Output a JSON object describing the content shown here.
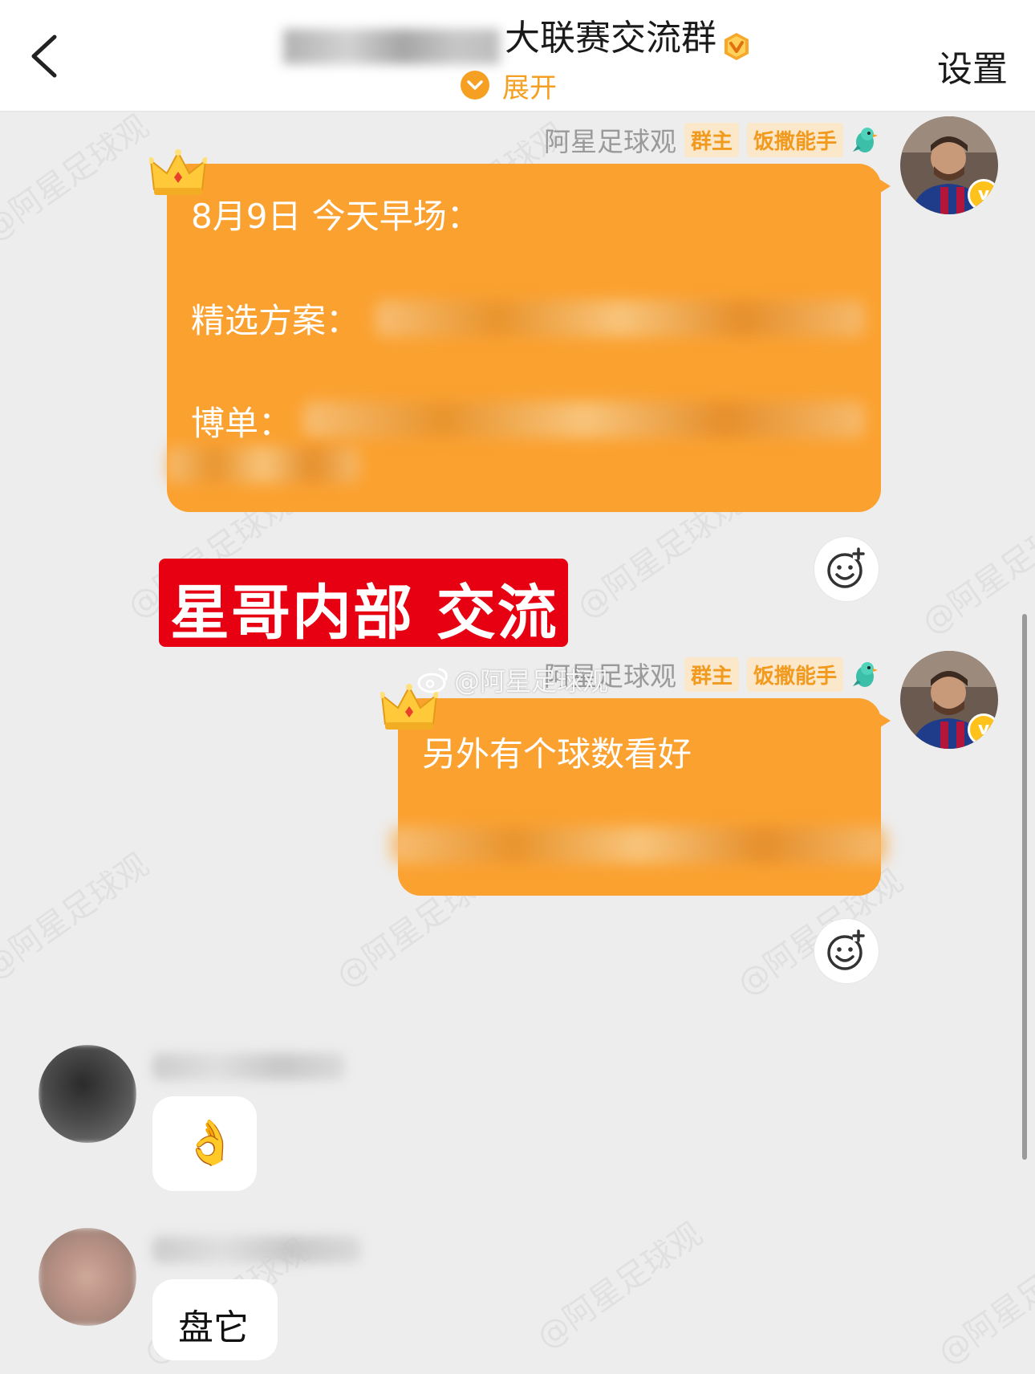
{
  "header": {
    "title": "大联赛交流群",
    "expand_label": "展开",
    "settings_label": "设置"
  },
  "messages": [
    {
      "sender": "阿星足球观",
      "tags": [
        "群主",
        "饭撒能手"
      ],
      "lines": [
        "8月9日  今天早场：",
        "精选方案：",
        "博单："
      ]
    },
    {
      "sender": "阿星足球观",
      "tags": [
        "群主",
        "饭撒能手"
      ],
      "lines": [
        "另外有个球数看好"
      ]
    }
  ],
  "banner": {
    "text": "星哥内部 交流"
  },
  "weibo_watermark": "@阿星足球观",
  "watermark_text": "@阿星足球观",
  "left_messages": [
    {
      "content": "👌"
    },
    {
      "content": "盘它"
    }
  ],
  "colors": {
    "accent": "#f5a023",
    "bubble": "#fba130",
    "banner": "#e60012",
    "tag_bg": "#fbe7c9",
    "tag_text": "#f29a1e"
  }
}
